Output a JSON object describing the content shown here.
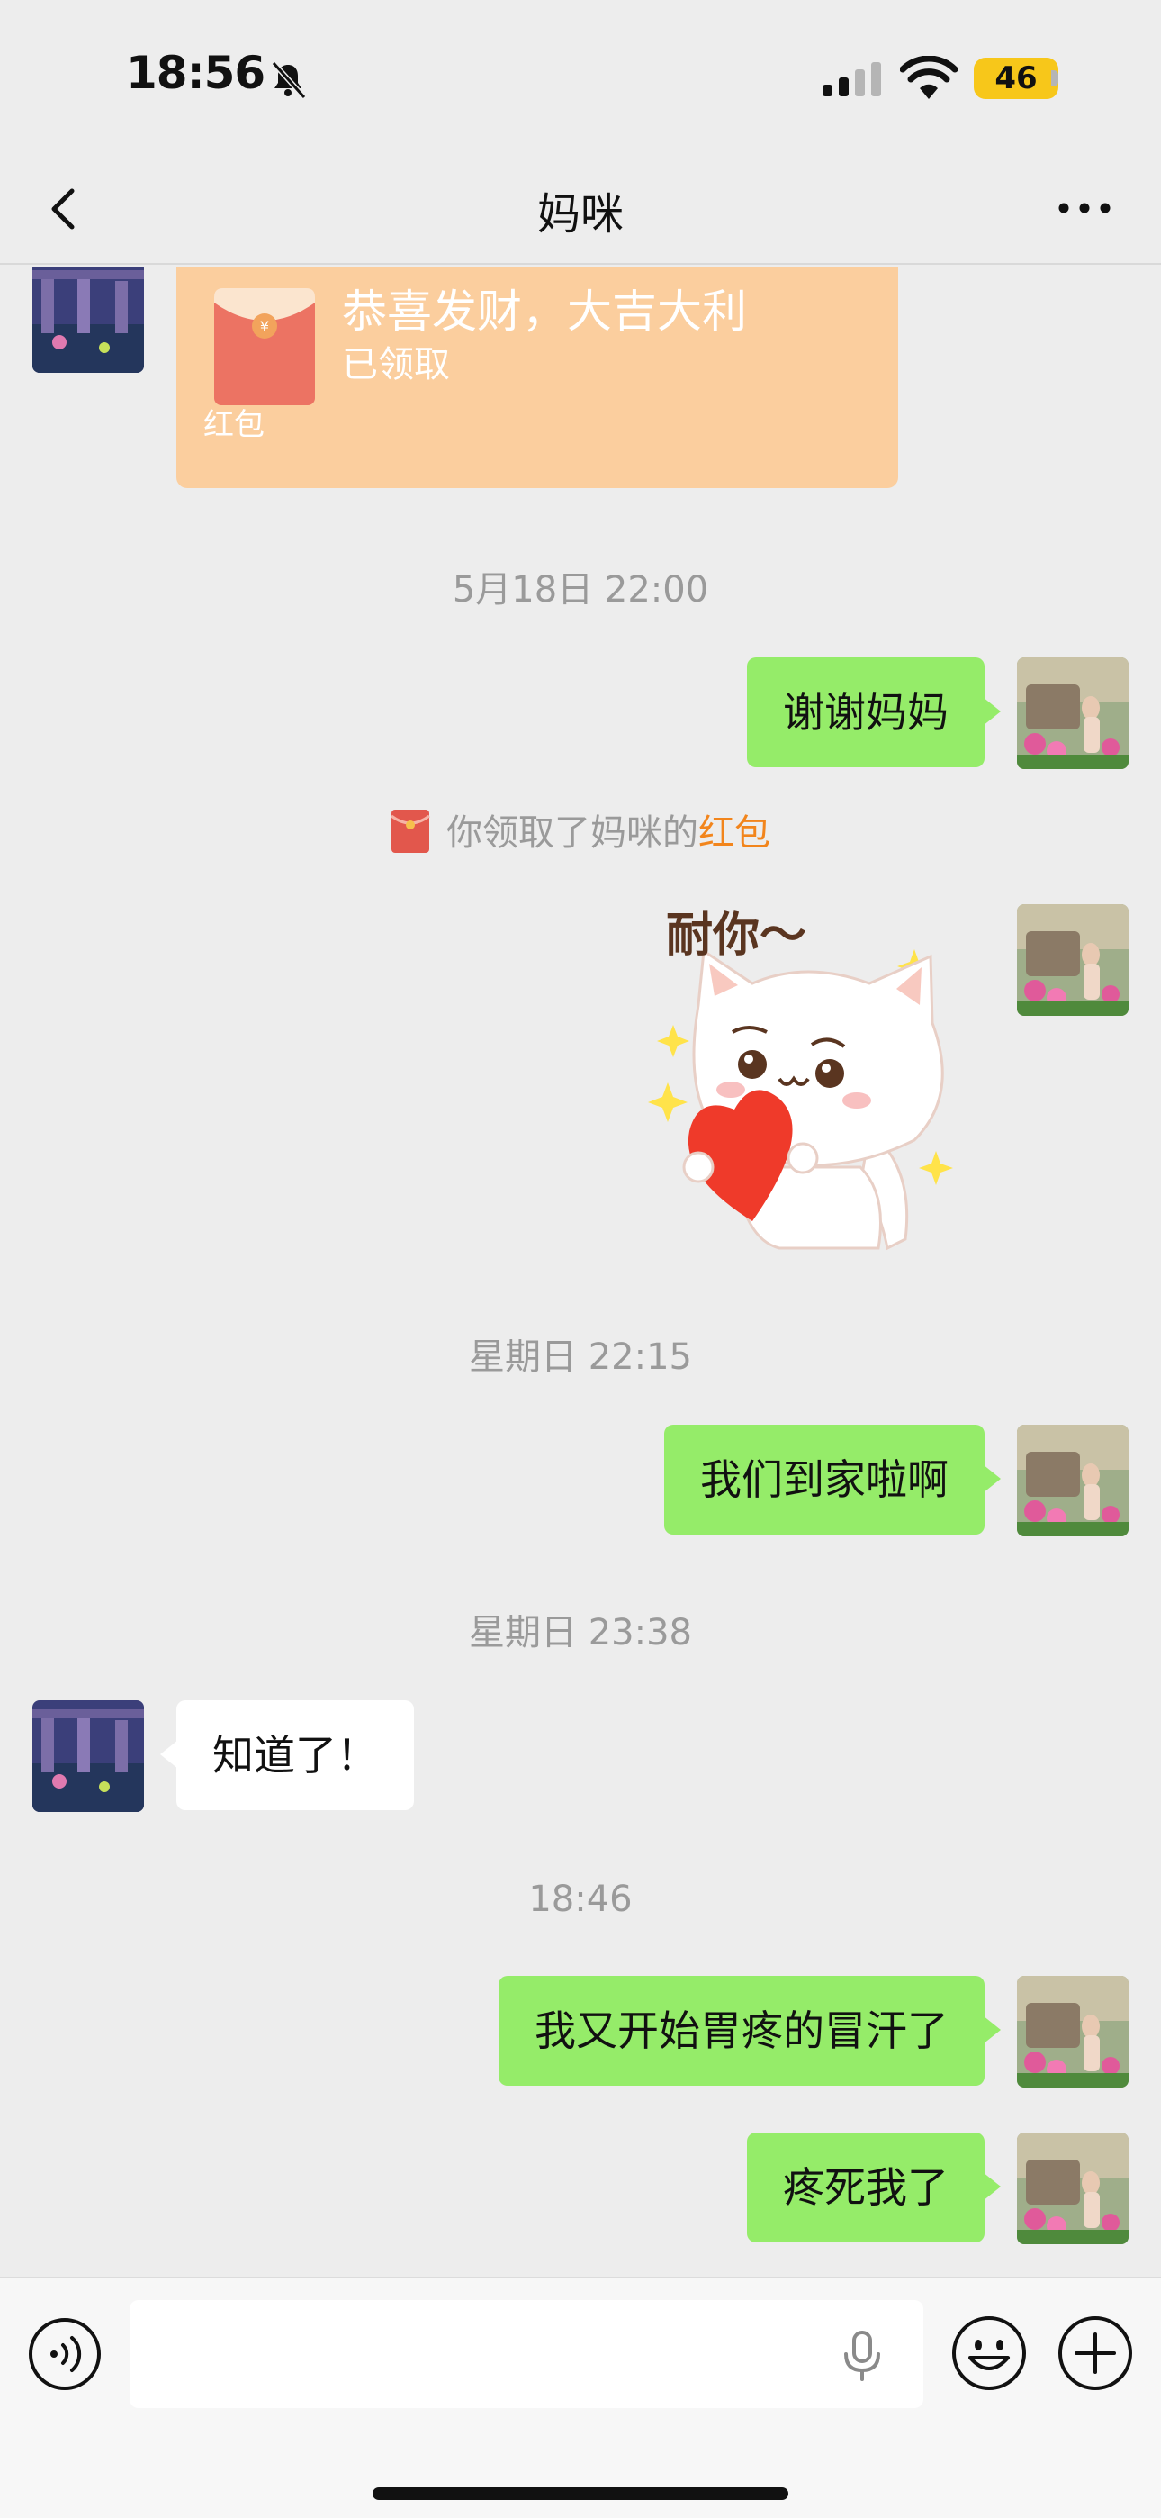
{
  "status_bar": {
    "time": "18:56",
    "battery": "46"
  },
  "nav": {
    "title": "妈咪",
    "back_icon": "chevron-left-icon",
    "more_icon": "more-dots-icon"
  },
  "messages": {
    "redpacket": {
      "title": "恭喜发财，大吉大利",
      "status": "已领取",
      "label": "红包"
    },
    "time1": "5月18日 22:00",
    "out1": "谢谢妈妈",
    "system_note": {
      "prefix": "你领取了妈咪的",
      "link": "红包"
    },
    "sticker_text": "耐你～",
    "time2": "星期日 22:15",
    "out2": "我们到家啦啊",
    "time3": "星期日 23:38",
    "in1": "知道了！",
    "time4": "18:46",
    "out3": "我又开始胃疼的冒汗了",
    "out4": "疼死我了"
  },
  "colors": {
    "outgoing_bubble": "#95ec69",
    "incoming_bubble": "#ffffff",
    "redpacket": "#fbce9e",
    "link": "#f2851c",
    "background": "#ededed"
  },
  "input_bar": {
    "placeholder": ""
  }
}
